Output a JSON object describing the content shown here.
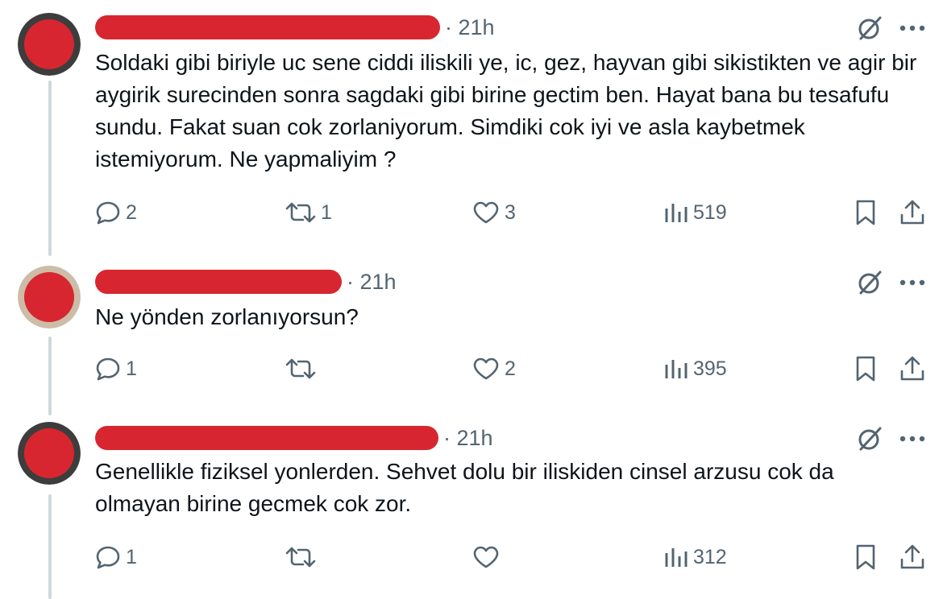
{
  "colors": {
    "redaction": "#d7262f",
    "muted": "#536471",
    "text": "#0f1419",
    "thread_line": "#cfd9de"
  },
  "tweets": [
    {
      "time": "21h",
      "text": "Soldaki gibi biriyle uc sene ciddi iliskili ye, ic, gez, hayvan gibi sikistikten ve agir bir aygirik surecinden sonra sagdaki gibi birine gectim ben. Hayat bana bu tesafufu sundu. Fakat suan cok zorlaniyorum. Simdiki cok iyi ve asla kaybetmek istemiyorum. Ne yapmaliyim ?",
      "replies": "2",
      "reposts": "1",
      "likes": "3",
      "views": "519"
    },
    {
      "time": "21h",
      "text": "Ne yönden zorlanıyorsun?",
      "replies": "1",
      "reposts": "",
      "likes": "2",
      "views": "395"
    },
    {
      "time": "21h",
      "text": "Genellikle fiziksel yonlerden. Sehvet dolu bir iliskiden cinsel arzusu cok da olmayan birine gecmek cok zor.",
      "replies": "1",
      "reposts": "",
      "likes": "",
      "views": "312"
    }
  ],
  "icons": [
    "reply-icon",
    "repost-icon",
    "like-icon",
    "views-icon",
    "bookmark-icon",
    "share-icon",
    "grok-icon",
    "more-icon"
  ]
}
